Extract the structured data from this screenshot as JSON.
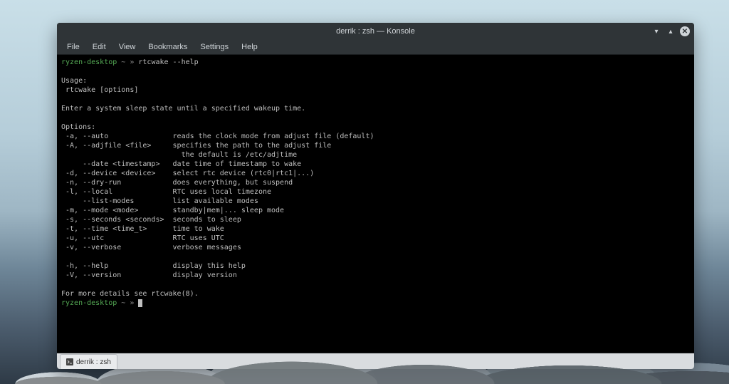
{
  "window": {
    "title": "derrik : zsh — Konsole",
    "controls": {
      "min": "▾",
      "max": "▴",
      "close": "✕"
    }
  },
  "menubar": [
    "File",
    "Edit",
    "View",
    "Bookmarks",
    "Settings",
    "Help"
  ],
  "prompt1": {
    "host": "ryzen-desktop",
    "sep": " ~ » ",
    "cmd": "rtcwake --help"
  },
  "output": {
    "l00": "",
    "l01": "Usage:",
    "l02": " rtcwake [options]",
    "l03": "",
    "l04": "Enter a system sleep state until a specified wakeup time.",
    "l05": "",
    "l06": "Options:",
    "l07": " -a, --auto               reads the clock mode from adjust file (default)",
    "l08": " -A, --adjfile <file>     specifies the path to the adjust file",
    "l09": "                            the default is /etc/adjtime",
    "l10": "     --date <timestamp>   date time of timestamp to wake",
    "l11": " -d, --device <device>    select rtc device (rtc0|rtc1|...)",
    "l12": " -n, --dry-run            does everything, but suspend",
    "l13": " -l, --local              RTC uses local timezone",
    "l14": "     --list-modes         list available modes",
    "l15": " -m, --mode <mode>        standby|mem|... sleep mode",
    "l16": " -s, --seconds <seconds>  seconds to sleep",
    "l17": " -t, --time <time_t>      time to wake",
    "l18": " -u, --utc                RTC uses UTC",
    "l19": " -v, --verbose            verbose messages",
    "l20": "",
    "l21": " -h, --help               display this help",
    "l22": " -V, --version            display version",
    "l23": "",
    "l24": "For more details see rtcwake(8)."
  },
  "prompt2": {
    "host": "ryzen-desktop",
    "sep": " ~ » "
  },
  "tab": {
    "label": "derrik : zsh"
  }
}
